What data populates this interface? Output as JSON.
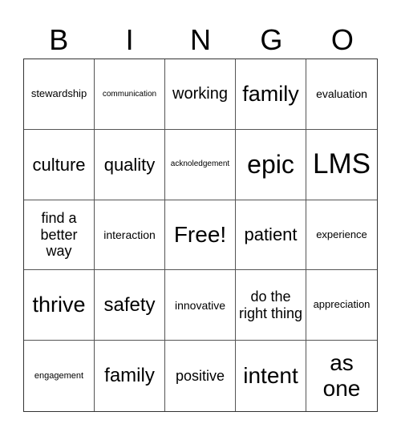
{
  "header": [
    "B",
    "I",
    "N",
    "G",
    "O"
  ],
  "cells": [
    "stewardship",
    "communication",
    "working",
    "family",
    "evaluation",
    "culture",
    "quality",
    "acknoledgement",
    "epic",
    "LMS",
    "find a better way",
    "interaction",
    "Free!",
    "patient",
    "experience",
    "thrive",
    "safety",
    "innovative",
    "do the right thing",
    "appreciation",
    "engagement",
    "family",
    "positive",
    "intent",
    "as one"
  ]
}
